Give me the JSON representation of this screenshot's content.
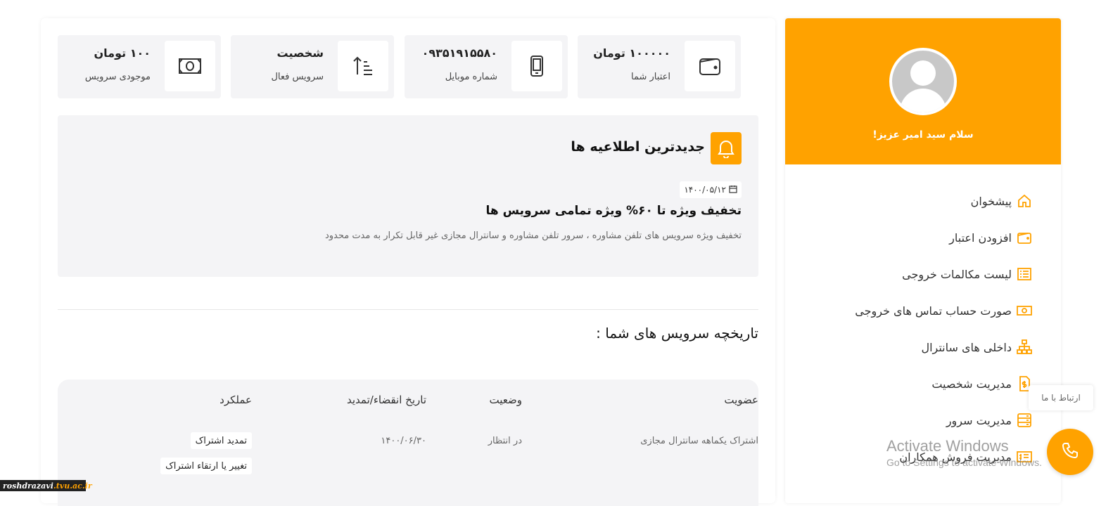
{
  "colors": {
    "accent": "#ffa200",
    "panel": "#f4f4f6"
  },
  "profile": {
    "greeting": "سلام سید امیر عزیز!"
  },
  "menu": [
    {
      "label": "پیشخوان",
      "icon": "home-icon"
    },
    {
      "label": "افزودن اعتبار",
      "icon": "wallet-icon"
    },
    {
      "label": "لیست مکالمات خروجی",
      "icon": "list-icon"
    },
    {
      "label": "صورت حساب تماس های خروجی",
      "icon": "money-icon"
    },
    {
      "label": "داخلی های سانترال",
      "icon": "sitemap-icon"
    },
    {
      "label": "مدیریت شخصیت",
      "icon": "document-dollar-icon"
    },
    {
      "label": "مدیریت سرور",
      "icon": "server-icon"
    },
    {
      "label": "مدیریت فروش همکاران",
      "icon": "sales-icon"
    }
  ],
  "stats": [
    {
      "value": "۱۰۰۰۰۰ تومان",
      "label": "اعتبار شما",
      "icon": "wallet-icon"
    },
    {
      "value": "۰۹۳۵۱۹۱۵۵۸۰",
      "label": "شماره موبایل",
      "icon": "mobile-icon"
    },
    {
      "value": "شخصیت",
      "label": "سرویس فعال",
      "icon": "sort-ascending-icon"
    },
    {
      "value": "۱۰۰ تومان",
      "label": "موجودی سرویس",
      "icon": "money-icon"
    }
  ],
  "notice": {
    "title": "جدیدترین اطلاعیه ها",
    "date": "۱۴۰۰/۰۵/۱۲",
    "headline": "تخفیف ویژه تا ۶۰% ویژه تمامی سرویس ها",
    "body": "تخفیف ویژه سرویس های تلفن مشاوره ، سرور تلفن مشاوره و سانترال مجازی غیر قابل تکرار به مدت محدود"
  },
  "history": {
    "title": "تاریخچه سرویس های شما :",
    "columns": [
      "عضویت",
      "وضعیت",
      "تاریخ انقضاء/تمدید",
      "عملکرد"
    ],
    "rows": [
      {
        "membership": "اشتراک یکماهه سانترال مجازی",
        "status": "در انتظار",
        "expiry": "۱۴۰۰/۰۶/۳۰",
        "actions": [
          "تمدید اشتراک",
          "تغییر یا ارتقاء اشتراک"
        ]
      }
    ]
  },
  "contact": {
    "label": "ارتباط با ما"
  },
  "watermark": {
    "line1": "Activate Windows",
    "line2": "Go to Settings to activate Windows."
  },
  "site_tag": {
    "part1": "roshdrazavi",
    "part2": ".tvu.ac.ir"
  }
}
